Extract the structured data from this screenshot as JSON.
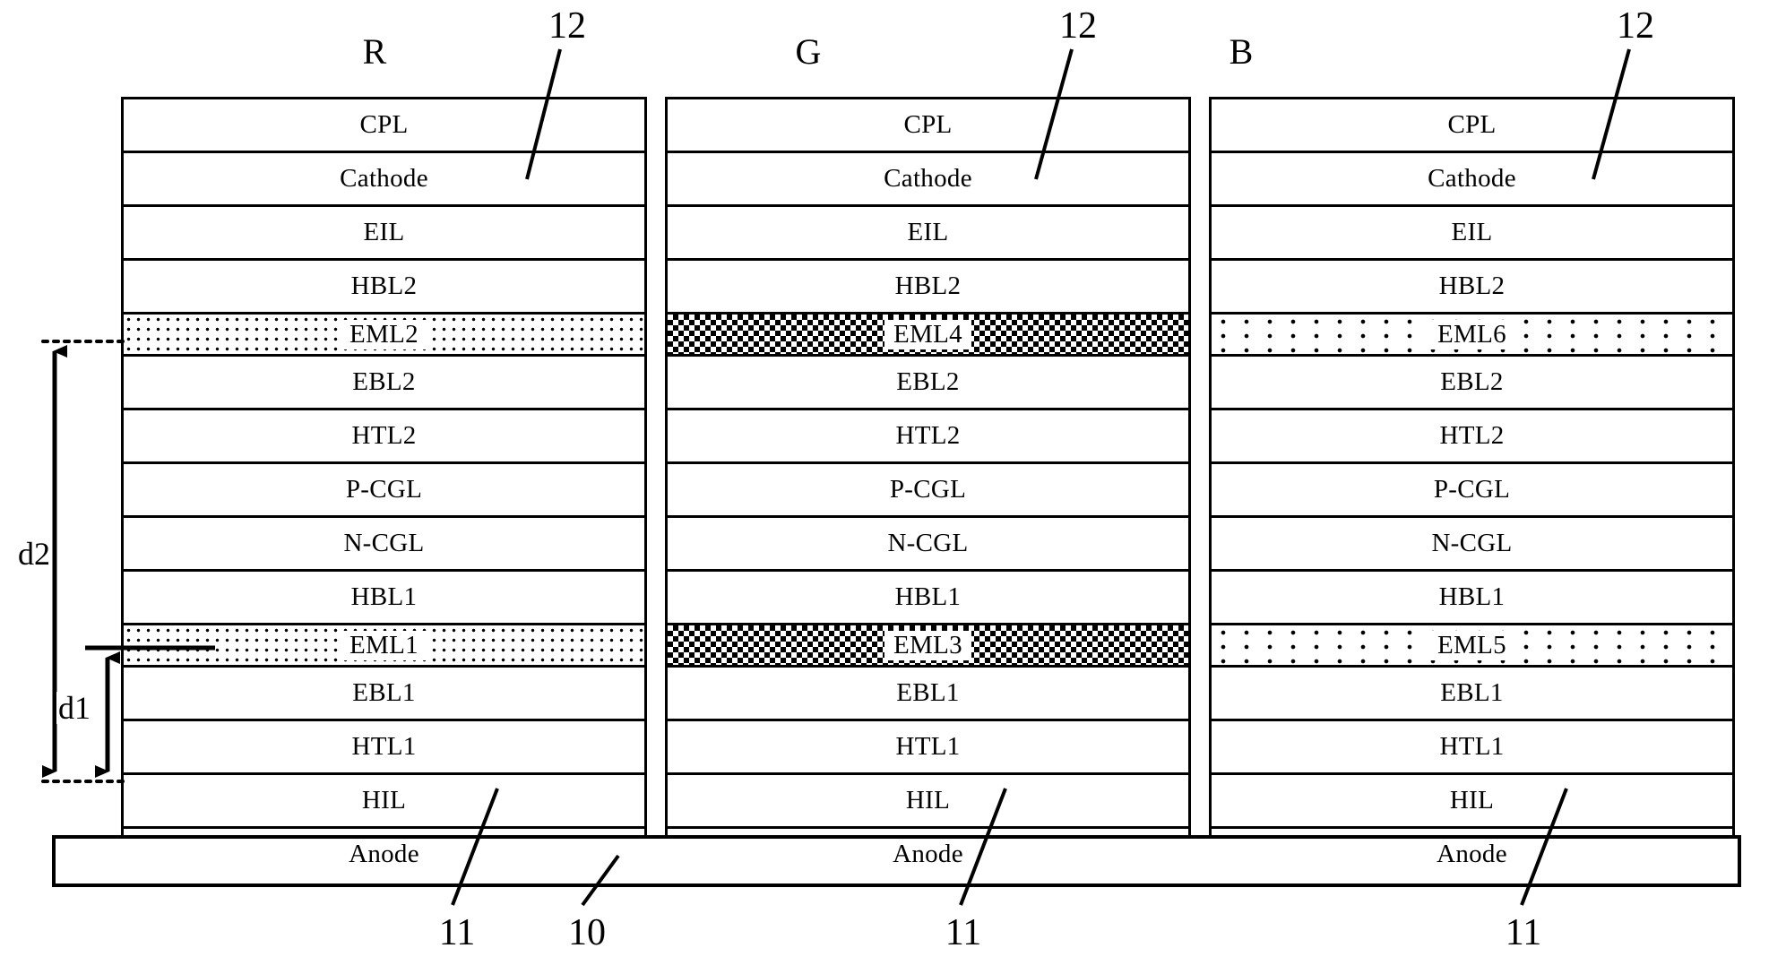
{
  "figure": {
    "type": "patent-cross-section-diagram",
    "subject": "OLED tandem device stack for R, G, B subpixels"
  },
  "columns": [
    {
      "id": "R",
      "letter": "R",
      "hatch_pattern": "dot-medium",
      "layers": [
        {
          "name": "CPL",
          "hatched": false
        },
        {
          "name": "Cathode",
          "hatched": false
        },
        {
          "name": "EIL",
          "hatched": false
        },
        {
          "name": "HBL2",
          "hatched": false
        },
        {
          "name": "EML2",
          "hatched": true
        },
        {
          "name": "EBL2",
          "hatched": false
        },
        {
          "name": "HTL2",
          "hatched": false
        },
        {
          "name": "P-CGL",
          "hatched": false
        },
        {
          "name": "N-CGL",
          "hatched": false
        },
        {
          "name": "HBL1",
          "hatched": false
        },
        {
          "name": "EML1",
          "hatched": true
        },
        {
          "name": "EBL1",
          "hatched": false
        },
        {
          "name": "HTL1",
          "hatched": false
        },
        {
          "name": "HIL",
          "hatched": false
        },
        {
          "name": "Anode",
          "hatched": false
        }
      ]
    },
    {
      "id": "G",
      "letter": "G",
      "hatch_pattern": "checker-dense",
      "layers": [
        {
          "name": "CPL",
          "hatched": false
        },
        {
          "name": "Cathode",
          "hatched": false
        },
        {
          "name": "EIL",
          "hatched": false
        },
        {
          "name": "HBL2",
          "hatched": false
        },
        {
          "name": "EML4",
          "hatched": true
        },
        {
          "name": "EBL2",
          "hatched": false
        },
        {
          "name": "HTL2",
          "hatched": false
        },
        {
          "name": "P-CGL",
          "hatched": false
        },
        {
          "name": "N-CGL",
          "hatched": false
        },
        {
          "name": "HBL1",
          "hatched": false
        },
        {
          "name": "EML3",
          "hatched": true
        },
        {
          "name": "EBL1",
          "hatched": false
        },
        {
          "name": "HTL1",
          "hatched": false
        },
        {
          "name": "HIL",
          "hatched": false
        },
        {
          "name": "Anode",
          "hatched": false
        }
      ]
    },
    {
      "id": "B",
      "letter": "B",
      "hatch_pattern": "dot-sparse",
      "layers": [
        {
          "name": "CPL",
          "hatched": false
        },
        {
          "name": "Cathode",
          "hatched": false
        },
        {
          "name": "EIL",
          "hatched": false
        },
        {
          "name": "HBL2",
          "hatched": false
        },
        {
          "name": "EML6",
          "hatched": true
        },
        {
          "name": "EBL2",
          "hatched": false
        },
        {
          "name": "HTL2",
          "hatched": false
        },
        {
          "name": "P-CGL",
          "hatched": false
        },
        {
          "name": "N-CGL",
          "hatched": false
        },
        {
          "name": "HBL1",
          "hatched": false
        },
        {
          "name": "EML5",
          "hatched": true
        },
        {
          "name": "EBL1",
          "hatched": false
        },
        {
          "name": "HTL1",
          "hatched": false
        },
        {
          "name": "HIL",
          "hatched": false
        },
        {
          "name": "Anode",
          "hatched": false
        }
      ]
    }
  ],
  "dimensions": {
    "d2": "d2",
    "d1": "d1"
  },
  "reference_numerals": {
    "stack_top_r": "12",
    "stack_top_g": "12",
    "stack_top_b": "12",
    "anode_r": "11",
    "substrate": "10",
    "anode_g": "11",
    "anode_b": "11"
  }
}
